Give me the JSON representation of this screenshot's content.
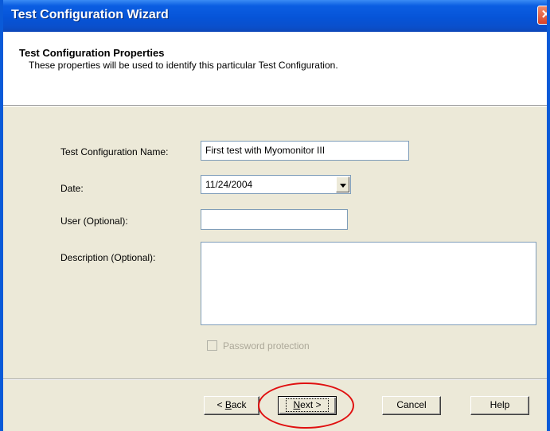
{
  "window": {
    "title": "Test Configuration Wizard",
    "close_glyph": "✕"
  },
  "header": {
    "title": "Test Configuration Properties",
    "subtitle": "These properties will be used to identify this particular Test Configuration."
  },
  "form": {
    "name_label": "Test Configuration Name:",
    "name_value": "First test with Myomonitor III",
    "date_label": "Date:",
    "date_value": "11/24/2004",
    "user_label": "User (Optional):",
    "user_value": "",
    "description_label": "Description (Optional):",
    "description_value": "",
    "password_label": "Password protection",
    "password_checked": false,
    "password_enabled": false
  },
  "buttons": {
    "back": {
      "prefix": "< ",
      "accel": "B",
      "rest": "ack"
    },
    "next": {
      "accel": "N",
      "rest": "ext >"
    },
    "cancel": "Cancel",
    "help": "Help"
  },
  "annotation": {
    "color": "#e01010"
  },
  "colors": {
    "titlebar": "#0654d8",
    "face": "#ece9d8",
    "input_border": "#7f9db9"
  }
}
